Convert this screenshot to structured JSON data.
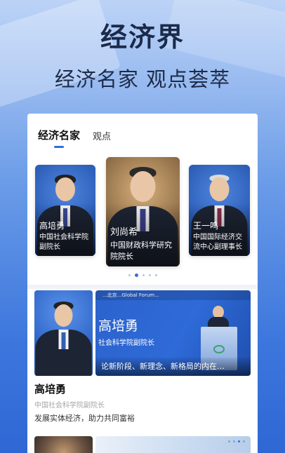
{
  "header": {
    "title": "经济界",
    "subtitle": "经济名家 观点荟萃"
  },
  "tabs": [
    {
      "label": "经济名家",
      "active": true
    },
    {
      "label": "观点",
      "active": false
    }
  ],
  "carousel": {
    "cards": [
      {
        "name": "高培勇",
        "title": "中国社会科学院副院长"
      },
      {
        "name": "刘尚希",
        "title": "中国财政科学研究院院长"
      },
      {
        "name": "王一鸣",
        "title": "中国国际经济交流中心副理事长"
      }
    ],
    "active_index": 1,
    "dot_count": 5
  },
  "featured": {
    "banner_top_text": "...北京...Global Forum...",
    "overlay_name": "高培勇",
    "overlay_title": "社会科学院副院长",
    "caption": "论新阶段、新理念、新格局的内在…",
    "name": "高培勇",
    "title": "中国社会科学院副院长",
    "headline": "发展实体经济，助力共同富裕"
  },
  "colors": {
    "accent": "#2f6fe0",
    "background_top": "#bcd3f6",
    "background_bottom": "#2f67d4"
  }
}
